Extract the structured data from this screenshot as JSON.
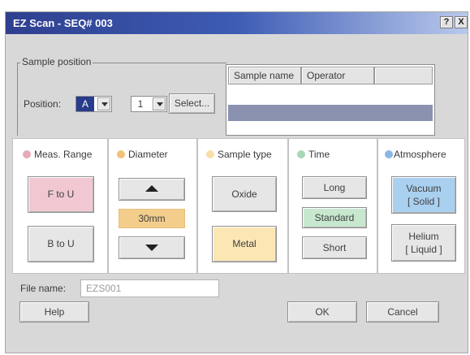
{
  "window": {
    "title": "EZ Scan - SEQ# 003",
    "help_btn": "?",
    "close_btn": "X"
  },
  "sample_position": {
    "group_label": "Sample position",
    "position_label": "Position:",
    "position_value": "A",
    "slot_value": "1",
    "select_label": "Select..."
  },
  "sample_table": {
    "columns": [
      "Sample name",
      "Operator",
      ""
    ]
  },
  "meas_range": {
    "label": "Meas. Range",
    "color": "#e8aab8",
    "options": [
      "F to U",
      "B to U"
    ],
    "selected": "F to U"
  },
  "diameter": {
    "label": "Diameter",
    "color": "#f0c27a",
    "value": "30mm",
    "up_icon": "arrow-up-icon",
    "down_icon": "arrow-down-icon"
  },
  "sample_type": {
    "label": "Sample type",
    "color": "#f8dfa8",
    "options": [
      "Oxide",
      "Metal"
    ],
    "selected": "Metal"
  },
  "time": {
    "label": "Time",
    "color": "#a8d8b4",
    "options": [
      "Long",
      "Standard",
      "Short"
    ],
    "selected": "Standard"
  },
  "atmosphere": {
    "label": "Atmosphere",
    "color": "#8ab8e6",
    "options": [
      "Vacuum\n[ Solid ]",
      "Helium\n[ Liquid ]"
    ],
    "selected": "Vacuum\n[ Solid ]"
  },
  "file": {
    "label": "File name:",
    "value": "EZS001"
  },
  "buttons": {
    "help": "Help",
    "ok": "OK",
    "cancel": "Cancel"
  }
}
